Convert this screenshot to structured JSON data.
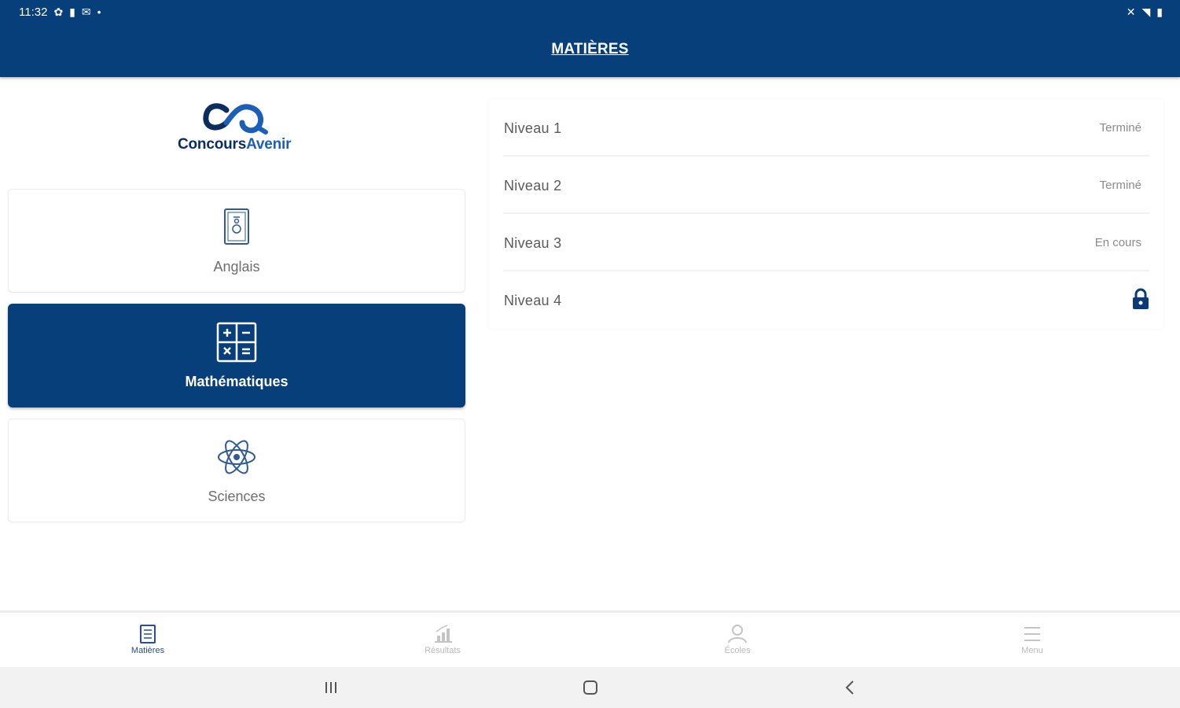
{
  "status_bar": {
    "time": "11:32",
    "left_icons": [
      "settings-icon",
      "profile-icon",
      "mail-icon",
      "dot-icon"
    ],
    "right_icons": [
      "mute-icon",
      "wifi-icon",
      "battery-icon"
    ]
  },
  "app_bar": {
    "title": "MATIÈRES"
  },
  "logo": {
    "text_part1": "Concours",
    "text_part2": "Avenir"
  },
  "subjects": [
    {
      "label": "Anglais",
      "icon": "book-icon",
      "active": false
    },
    {
      "label": "Mathématiques",
      "icon": "calculator-icon",
      "active": true
    },
    {
      "label": "Sciences",
      "icon": "atom-icon",
      "active": false
    }
  ],
  "levels": [
    {
      "name": "Niveau 1",
      "status": "Terminé"
    },
    {
      "name": "Niveau 2",
      "status": "Terminé"
    },
    {
      "name": "Niveau 3",
      "status": "En cours"
    },
    {
      "name": "Niveau 4",
      "status": "",
      "locked": true,
      "icon": "lock-icon"
    }
  ],
  "bottom_nav": [
    {
      "label": "Matières",
      "icon": "subjects-icon",
      "active": true
    },
    {
      "label": "Résultats",
      "icon": "results-icon",
      "active": false
    },
    {
      "label": "Écoles",
      "icon": "schools-icon",
      "active": false
    },
    {
      "label": "Menu",
      "icon": "menu-icon",
      "active": false
    }
  ],
  "colors": {
    "primary": "#073f7a",
    "accent": "#1b5fb8",
    "text_muted": "#6e6e6e",
    "inactive": "#b9b9b9"
  }
}
